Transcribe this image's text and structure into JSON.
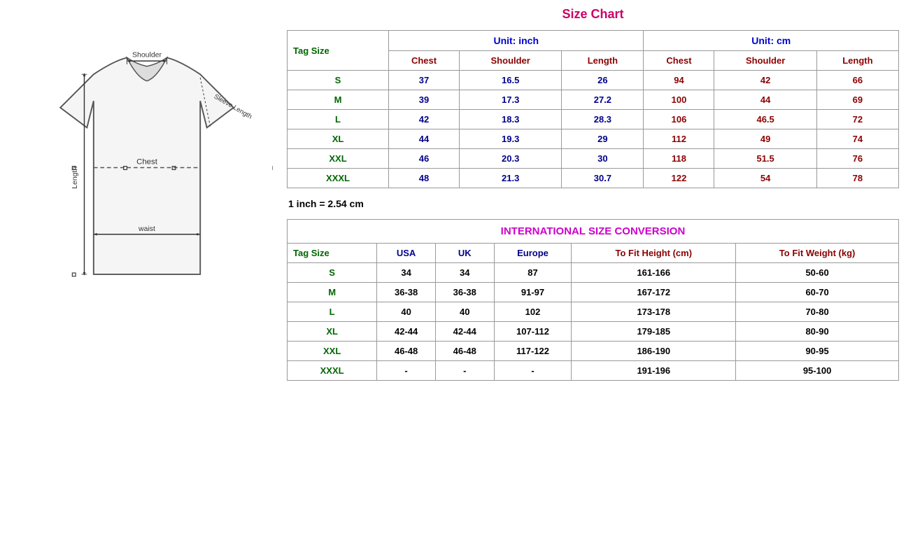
{
  "title": "Size Chart",
  "sizeChart": {
    "unitInch": "Unit: inch",
    "unitCm": "Unit: cm",
    "tagSizeLabel": "Tag Size",
    "headers": {
      "chest": "Chest",
      "shoulder": "Shoulder",
      "length": "Length"
    },
    "rows": [
      {
        "tag": "S",
        "inchChest": "37",
        "inchShoulder": "16.5",
        "inchLength": "26",
        "cmChest": "94",
        "cmShoulder": "42",
        "cmLength": "66"
      },
      {
        "tag": "M",
        "inchChest": "39",
        "inchShoulder": "17.3",
        "inchLength": "27.2",
        "cmChest": "100",
        "cmShoulder": "44",
        "cmLength": "69"
      },
      {
        "tag": "L",
        "inchChest": "42",
        "inchShoulder": "18.3",
        "inchLength": "28.3",
        "cmChest": "106",
        "cmShoulder": "46.5",
        "cmLength": "72"
      },
      {
        "tag": "XL",
        "inchChest": "44",
        "inchShoulder": "19.3",
        "inchLength": "29",
        "cmChest": "112",
        "cmShoulder": "49",
        "cmLength": "74"
      },
      {
        "tag": "XXL",
        "inchChest": "46",
        "inchShoulder": "20.3",
        "inchLength": "30",
        "cmChest": "118",
        "cmShoulder": "51.5",
        "cmLength": "76"
      },
      {
        "tag": "XXXL",
        "inchChest": "48",
        "inchShoulder": "21.3",
        "inchLength": "30.7",
        "cmChest": "122",
        "cmShoulder": "54",
        "cmLength": "78"
      }
    ]
  },
  "conversionNote": "1 inch = 2.54 cm",
  "intlConversion": {
    "title": "INTERNATIONAL SIZE CONVERSION",
    "tagSizeLabel": "Tag Size",
    "headers": {
      "usa": "USA",
      "uk": "UK",
      "europe": "Europe",
      "toFitHeight": "To Fit Height (cm)",
      "toFitWeight": "To Fit Weight (kg)"
    },
    "rows": [
      {
        "tag": "S",
        "usa": "34",
        "uk": "34",
        "europe": "87",
        "height": "161-166",
        "weight": "50-60"
      },
      {
        "tag": "M",
        "usa": "36-38",
        "uk": "36-38",
        "europe": "91-97",
        "height": "167-172",
        "weight": "60-70"
      },
      {
        "tag": "L",
        "usa": "40",
        "uk": "40",
        "europe": "102",
        "height": "173-178",
        "weight": "70-80"
      },
      {
        "tag": "XL",
        "usa": "42-44",
        "uk": "42-44",
        "europe": "107-112",
        "height": "179-185",
        "weight": "80-90"
      },
      {
        "tag": "XXL",
        "usa": "46-48",
        "uk": "46-48",
        "europe": "117-122",
        "height": "186-190",
        "weight": "90-95"
      },
      {
        "tag": "XXXL",
        "usa": "-",
        "uk": "-",
        "europe": "-",
        "height": "191-196",
        "weight": "95-100"
      }
    ]
  },
  "diagram": {
    "shoulderLabel": "Shoulder",
    "sleeveLengthLabel": "Sleeve Length",
    "chestLabel": "Chest",
    "lengthLabel": "Length",
    "waistLabel": "waist"
  }
}
